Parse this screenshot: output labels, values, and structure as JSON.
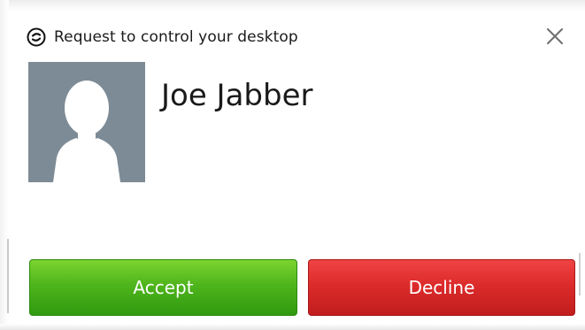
{
  "dialog": {
    "title": "Request to control your desktop",
    "contact_name": "Joe Jabber",
    "accept_label": "Accept",
    "decline_label": "Decline"
  },
  "icons": {
    "app": "jabber-logo-icon",
    "close": "close-icon",
    "avatar": "default-user-avatar"
  },
  "colors": {
    "accept": "#4fb51c",
    "decline": "#dc2b2b",
    "avatar_bg": "#7d8b96"
  }
}
